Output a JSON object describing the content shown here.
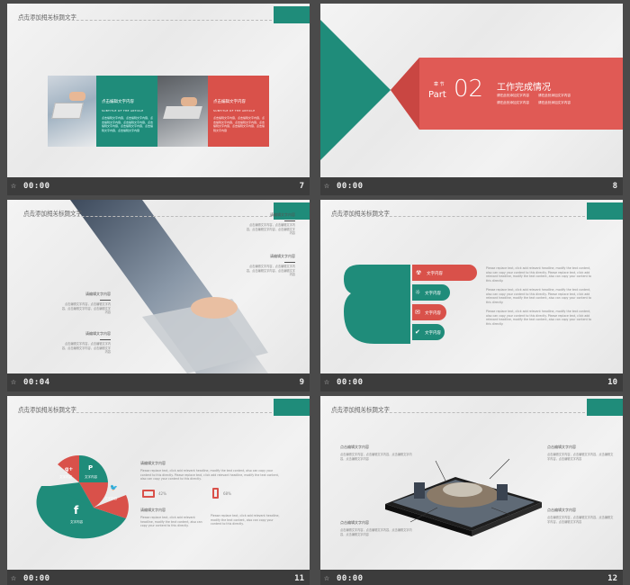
{
  "slides": [
    {
      "number": "7",
      "time": "00:00",
      "header": "点击添加相关标题文字",
      "teal_card": {
        "title": "点击编辑文字内容",
        "subtitle": "SUBTITLE OF THE ARTICLE",
        "body": "点击编辑文字内容，点击编辑文字内容，点击编辑文字内容，点击编辑文字内容，点击编辑文字内容，点击编辑文字内容，点击编辑文字内容，点击编辑文字内容"
      },
      "red_card": {
        "title": "点击编辑文字内容",
        "subtitle": "SUBTITLE OF THE ARTICLE",
        "body": "点击编辑文字内容，点击编辑文字内容，点击编辑文字内容，点击编辑文字内容，点击编辑文字内容，点击编辑文字内容，点击编辑文字内容"
      }
    },
    {
      "number": "8",
      "time": "00:00",
      "chapter": "章 节",
      "part": "Part",
      "part_num": "02",
      "title": "工作完成情况",
      "bullets": [
        "请在此处添加文字内容",
        "请在此处添加文字内容",
        "请在此处添加文字内容",
        "请在此处添加文字内容"
      ]
    },
    {
      "number": "9",
      "time": "00:04",
      "header": "点击添加相关标题文字",
      "items": [
        {
          "label": "请编辑文字内容",
          "body": "点击编辑文字内容，点击编辑文字内容，点击编辑文字内容，点击编辑文字内容"
        },
        {
          "label": "请编辑文字内容",
          "body": "点击编辑文字内容，点击编辑文字内容，点击编辑文字内容，点击编辑文字内容"
        },
        {
          "label": "请编辑文字内容",
          "body": "点击编辑文字内容，点击编辑文字内容，点击编辑文字内容，点击编辑文字内容"
        },
        {
          "label": "请编辑文字内容",
          "body": "点击编辑文字内容，点击编辑文字内容，点击编辑文字内容，点击编辑文字内容"
        }
      ]
    },
    {
      "number": "10",
      "time": "00:00",
      "header": "点击添加相关标题文字",
      "pills": [
        "文字内容",
        "文字内容",
        "文字内容",
        "文字内容"
      ],
      "paragraph": "Please replace text, click add relevant headline, modify the text content, also can copy your content to this directly. Please replace text, click add relevant headline, modify the text content, also can copy your content to this directly."
    },
    {
      "number": "11",
      "time": "00:00",
      "header": "点击添加相关标题文字",
      "pie_labels": [
        "文字内容",
        "文字内容",
        "文字内容",
        "文字内容"
      ],
      "text_title": "请编辑文字内容",
      "text_body": "Please replace text, click add relevant headline, modify the text content, also can copy your content to this directly. Please replace text, click add relevant headline, modify the text content, also can copy your content to this directly.",
      "stat1": "42%",
      "stat2": "68%",
      "text_title2": "请编辑文字内容",
      "text_body2": "Please replace text, click add relevant headline, modify the text content, also can copy your content to this directly."
    },
    {
      "number": "12",
      "time": "00:00",
      "header": "点击添加相关标题文字",
      "callouts": [
        {
          "label": "点击编辑文字内容",
          "body": "点击编辑文字内容，点击编辑文字内容，点击编辑文字内容，点击编辑文字内容"
        },
        {
          "label": "点击编辑文字内容",
          "body": "点击编辑文字内容，点击编辑文字内容，点击编辑文字内容，点击编辑文字内容"
        },
        {
          "label": "点击编辑文字内容",
          "body": "点击编辑文字内容，点击编辑文字内容，点击编辑文字内容，点击编辑文字内容"
        },
        {
          "label": "点击编辑文字内容",
          "body": "点击编辑文字内容，点击编辑文字内容，点击编辑文字内容，点击编辑文字内容"
        }
      ]
    }
  ],
  "colors": {
    "teal": "#1f8c7a",
    "red": "#d9514a",
    "footer": "#3c3c3c",
    "background": "#4a4a4a"
  }
}
